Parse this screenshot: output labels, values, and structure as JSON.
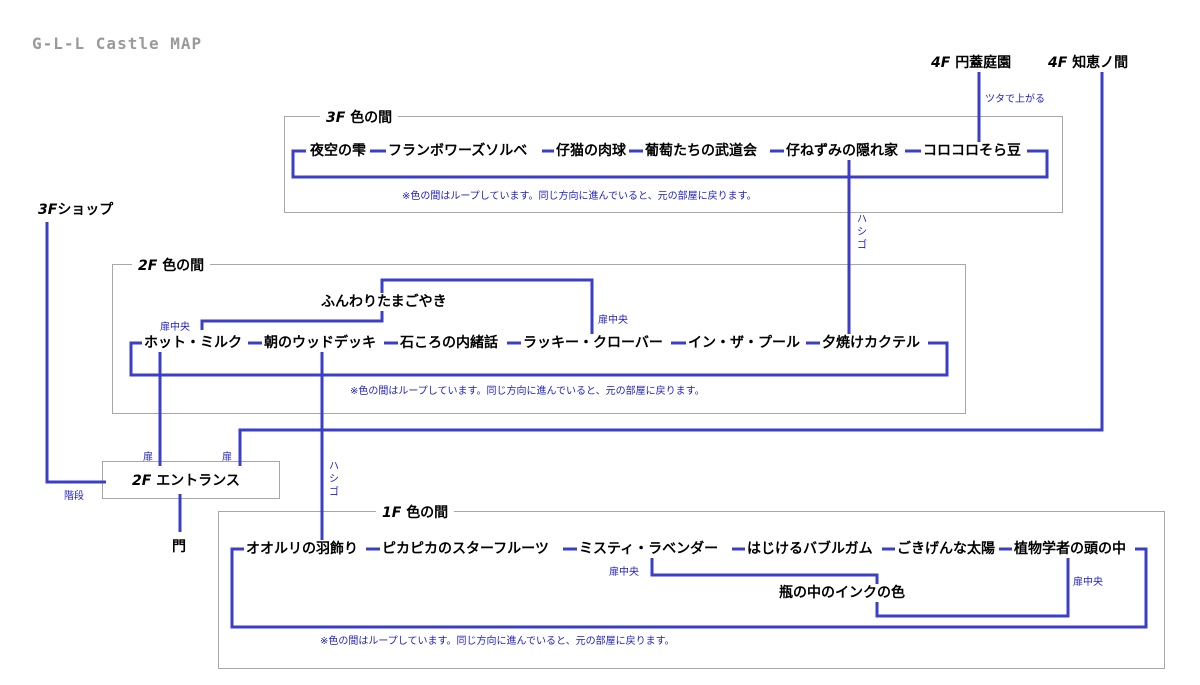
{
  "title": "G-L-L Castle MAP",
  "colors": {
    "line": "#3b3fc8",
    "frame": "#a8a8a8",
    "note": "#1e1ec8"
  },
  "floor3": {
    "label_num": "3F",
    "label_name": "色の間",
    "rooms": [
      "夜空の雫",
      "フランボワーズソルベ",
      "仔猫の肉球",
      "葡萄たちの武道会",
      "仔ねずみの隠れ家",
      "コロコロそら豆"
    ],
    "note": "※色の間はループしています。同じ方向に進んでいると、元の部屋に戻ります。"
  },
  "floor2": {
    "label_num": "2F",
    "label_name": "色の間",
    "upper_room": "ふんわりたまごやき",
    "rooms": [
      "ホット・ミルク",
      "朝のウッドデッキ",
      "石ころの内緒話",
      "ラッキー・クローバー",
      "イン・ザ・プール",
      "夕焼けカクテル"
    ],
    "note": "※色の間はループしています。同じ方向に進んでいると、元の部屋に戻ります。"
  },
  "floor1": {
    "label_num": "1F",
    "label_name": "色の間",
    "lower_room": "瓶の中のインクの色",
    "rooms": [
      "オオルリの羽飾り",
      "ピカピカのスターフルーツ",
      "ミスティ・ラベンダー",
      "はじけるバブルガム",
      "ごきげんな太陽",
      "植物学者の頭の中"
    ],
    "note": "※色の間はループしています。同じ方向に進んでいると、元の部屋に戻ります。"
  },
  "entrance": {
    "label_num": "2F",
    "label_name": "エントランス"
  },
  "gate": "門",
  "shop3f": {
    "label_num": "3F",
    "label_name": "ショップ"
  },
  "garden4f": {
    "label_num": "4F",
    "label_name": "円蓋庭園"
  },
  "wisdom4f": {
    "label_num": "4F",
    "label_name": "知恵ノ間"
  },
  "labels": {
    "ivy_up": "ツタで上がる",
    "ladder": "ハシゴ",
    "center_door": "扉中央",
    "door": "扉",
    "stairs": "階段"
  }
}
